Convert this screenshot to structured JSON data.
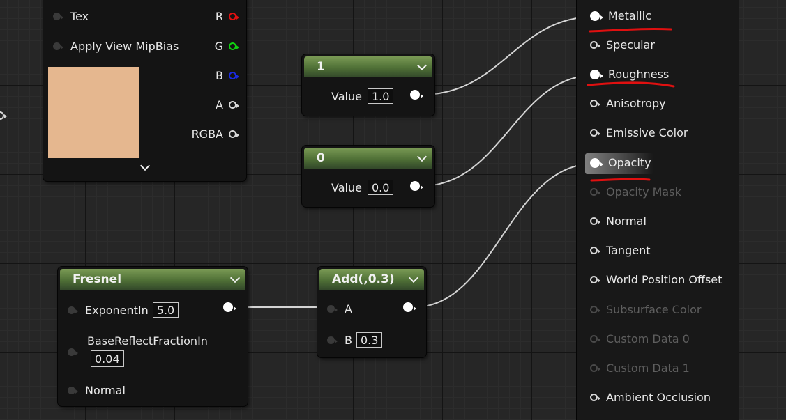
{
  "texture_node": {
    "inputs": [
      "Tex",
      "Apply View MipBias"
    ],
    "outputs": [
      "R",
      "G",
      "B",
      "A",
      "RGBA"
    ],
    "preview_color": "#e5b78f"
  },
  "const1": {
    "title": "1",
    "value_label": "Value",
    "value": "1.0"
  },
  "const0": {
    "title": "0",
    "value_label": "Value",
    "value": "0.0"
  },
  "fresnel": {
    "title": "Fresnel",
    "exponent_label": "ExponentIn",
    "exponent_value": "5.0",
    "base_label": "BaseReflectFractionIn",
    "base_value": "0.04",
    "normal_label": "Normal"
  },
  "add": {
    "title": "Add(,0.3)",
    "a_label": "A",
    "b_label": "B",
    "b_value": "0.3"
  },
  "material_result": {
    "pins": [
      "Metallic",
      "Specular",
      "Roughness",
      "Anisotropy",
      "Emissive Color",
      "Opacity",
      "Opacity Mask",
      "Normal",
      "Tangent",
      "World Position Offset",
      "Subsurface Color",
      "Custom Data 0",
      "Custom Data 1",
      "Ambient Occlusion"
    ]
  },
  "colors": {
    "header_green": "#5a7d3e",
    "annotation_red": "#e01010",
    "wire": "#d0d0d0"
  }
}
